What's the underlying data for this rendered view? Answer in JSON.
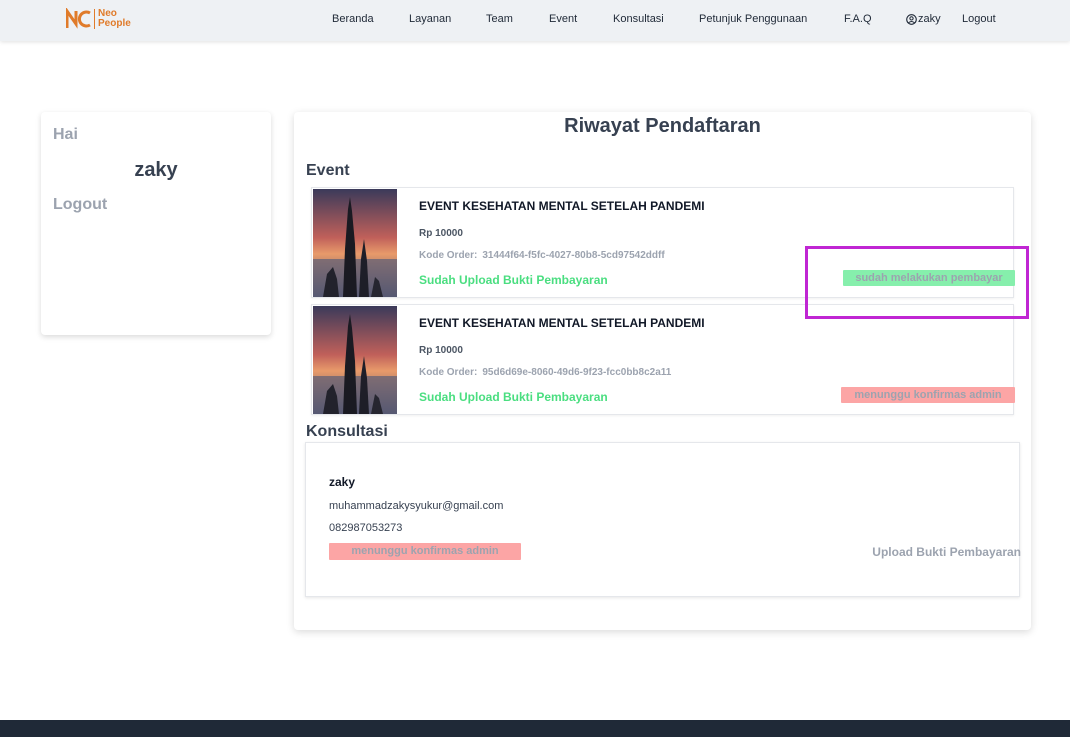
{
  "brand": {
    "line1": "Neo",
    "line2": "People"
  },
  "nav": {
    "items": [
      "Beranda",
      "Layanan",
      "Team",
      "Event",
      "Konsultasi",
      "Petunjuk Penggunaan",
      "F.A.Q"
    ],
    "user": "zaky",
    "logout": "Logout"
  },
  "sidebar": {
    "greeting": "Hai",
    "name": "zaky",
    "logout": "Logout"
  },
  "main": {
    "title": "Riwayat Pendaftaran",
    "event_label": "Event",
    "consult_label": "Konsultasi",
    "events": [
      {
        "title": "EVENT KESEHATAN MENTAL SETELAH PANDEMI",
        "price": "Rp 10000",
        "code_label": "Kode Order:",
        "code": "31444f64-f5fc-4027-80b8-5cd97542ddff",
        "upload_status": "Sudah Upload Bukti Pembayaran",
        "badge": "sudah melakukan pembayar",
        "badge_color": "#86efac"
      },
      {
        "title": "EVENT KESEHATAN MENTAL SETELAH PANDEMI",
        "price": "Rp 10000",
        "code_label": "Kode Order:",
        "code": "95d6d69e-8060-49d6-9f23-fcc0bb8c2a11",
        "upload_status": "Sudah Upload Bukti Pembayaran",
        "badge": "menunggu konfirmas admin",
        "badge_color": "#fca5a5"
      }
    ],
    "consultation": {
      "name": "zaky",
      "email": "muhammadzakysyukur@gmail.com",
      "phone": "082987053273",
      "badge": "menunggu konfirmas admin",
      "upload_link": "Upload Bukti Pembayaran"
    }
  },
  "colors": {
    "highlight": "#c026d3",
    "success": "#4ade80",
    "brand": "#e07b2a",
    "footer": "#1f2937"
  }
}
